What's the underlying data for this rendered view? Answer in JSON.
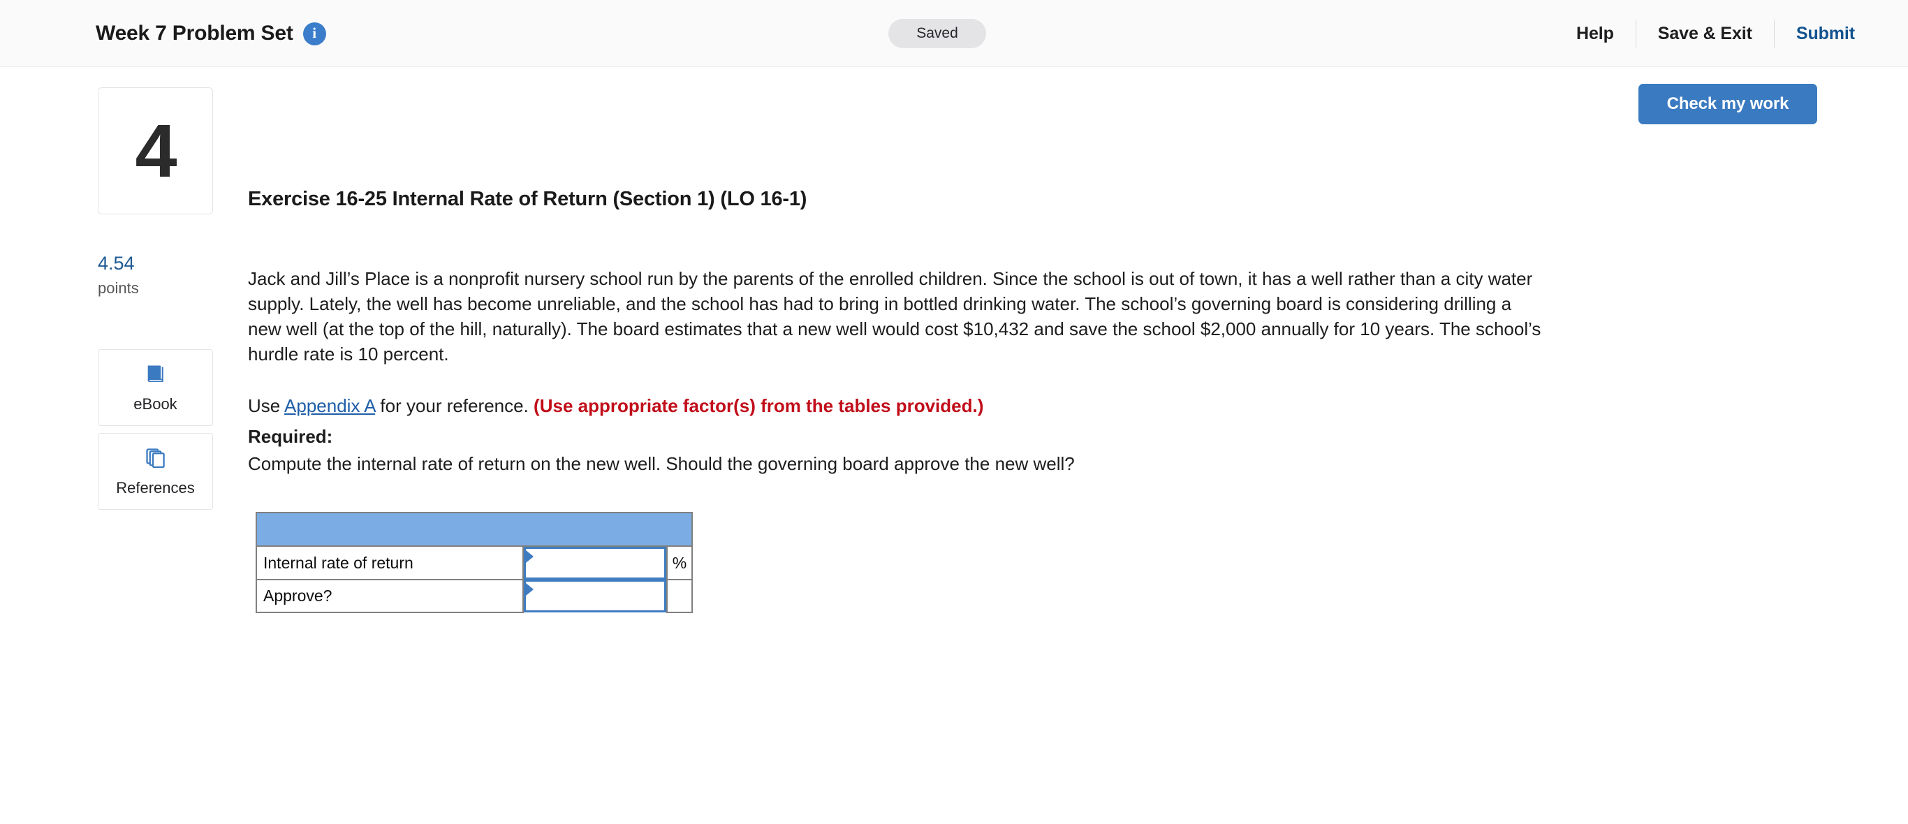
{
  "header": {
    "assignment_title": "Week 7 Problem Set",
    "info_icon": "info-icon",
    "info_glyph": "i",
    "save_status": "Saved",
    "links": [
      {
        "label": "Help",
        "style": "dark"
      },
      {
        "label": "Save & Exit",
        "style": "dark"
      },
      {
        "label": "Submit",
        "style": "blue"
      }
    ]
  },
  "toolbar": {
    "check_my_work_label": "Check my work"
  },
  "rail": {
    "question_number": "4",
    "points_value": "4.54",
    "points_label": "points",
    "buttons": [
      {
        "label": "eBook",
        "icon": "book-icon"
      },
      {
        "label": "References",
        "icon": "pages-stack-icon"
      }
    ]
  },
  "exercise": {
    "title": "Exercise 16-25 Internal Rate of Return (Section 1) (LO 16-1)",
    "body": "Jack and Jill’s Place is a nonprofit nursery school run by the parents of the enrolled children. Since the school is out of town, it has a well rather than a city water supply. Lately, the well has become unreliable, and the school has had to bring in bottled drinking water. The school’s governing board is considering drilling a new well (at the top of the hill, naturally). The board estimates that a new well would cost $10,432 and save the school $2,000 annually for 10 years. The school’s hurdle rate is 10 percent.",
    "appendix_prefix": "Use ",
    "appendix_link": "Appendix A",
    "appendix_suffix": " for your reference. ",
    "appendix_note": "(Use appropriate factor(s) from the tables provided.)",
    "required_label": "Required:",
    "required_text": "Compute the internal rate of return on the new well. Should the governing board approve the new well?"
  },
  "answer_table": {
    "header_band_color": "#7bace4",
    "header_label": "",
    "rows": [
      {
        "label": "Internal rate of return",
        "value": "",
        "unit": "%"
      },
      {
        "label": "Approve?",
        "value": "",
        "unit": ""
      }
    ]
  }
}
